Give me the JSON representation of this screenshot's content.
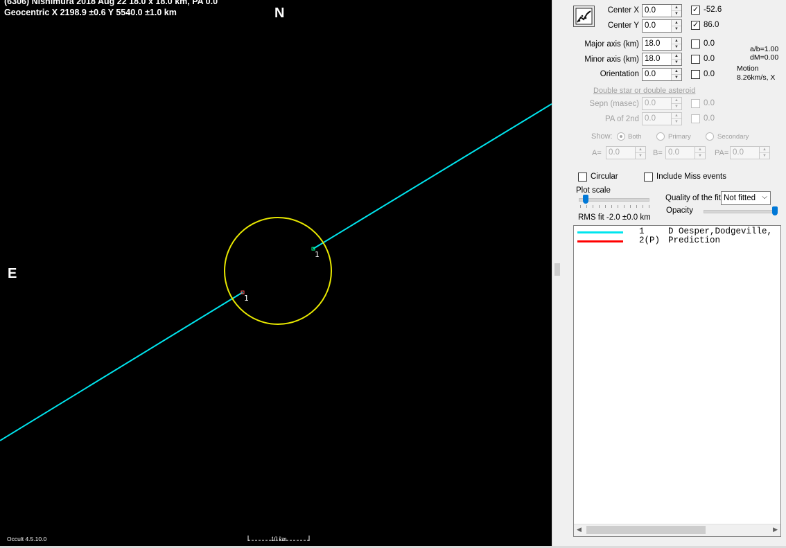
{
  "plot": {
    "title_line1": "(6306) Nishimura  2018 Aug 22   18.0 x 18.0 km, PA 0.0",
    "title_line2": "Geocentric  X  2198.9 ±0.6  Y 5540.0 ±1.0 km",
    "north_label": "N",
    "east_label": "E",
    "chord_labels": [
      "1",
      "1"
    ],
    "version": "Occult 4.5.10.0",
    "scale_label": "10 km",
    "colors": {
      "background": "#000000",
      "chord": "#00e5ee",
      "ellipse": "#e8e800",
      "prediction": "#ff0000"
    }
  },
  "panel": {
    "fit_button_icon": "fit-chart-icon",
    "center_x": {
      "label": "Center X",
      "value": "0.0",
      "checked": true,
      "result": "-52.6"
    },
    "center_y": {
      "label": "Center Y",
      "value": "0.0",
      "checked": true,
      "result": "86.0"
    },
    "major_axis": {
      "label": "Major axis (km)",
      "value": "18.0",
      "checked": false,
      "result": "0.0"
    },
    "minor_axis": {
      "label": "Minor axis (km)",
      "value": "18.0",
      "checked": false,
      "result": "0.0"
    },
    "orientation": {
      "label": "Orientation",
      "value": "0.0",
      "checked": false,
      "result": "0.0"
    },
    "ab_ratio": "a/b=1.00",
    "dm": "dM=0.00",
    "motion_label": "Motion",
    "motion_value": "8.26km/s, X",
    "double_header": "Double star  or  double asteroid",
    "sepn": {
      "label": "Sepn (masec)",
      "value": "0.0",
      "result": "0.0"
    },
    "pa2": {
      "label": "PA of 2nd",
      "value": "0.0",
      "result": "0.0"
    },
    "show_label": "Show:",
    "show_options": [
      "Both",
      "Primary",
      "Secondary"
    ],
    "a_label": "A=",
    "a_value": "0.0",
    "b_label": "B=",
    "b_value": "0.0",
    "pa_label": "PA=",
    "pa_value": "0.0",
    "circular_label": "Circular",
    "include_miss_label": "Include Miss events",
    "plot_scale_label": "Plot scale",
    "plot_scale_level": 0.1,
    "quality_label": "Quality of the fit",
    "quality_value": "Not fitted",
    "opacity_label": "Opacity",
    "opacity_level": 1.0,
    "rms_label": "RMS fit -2.0 ±0.0 km"
  },
  "legend": [
    {
      "number": "1",
      "text": "D Oesper,Dodgeville,",
      "color": "#00e5ee"
    },
    {
      "number": "2(P)",
      "text": "Prediction",
      "color": "#ff0000"
    }
  ]
}
